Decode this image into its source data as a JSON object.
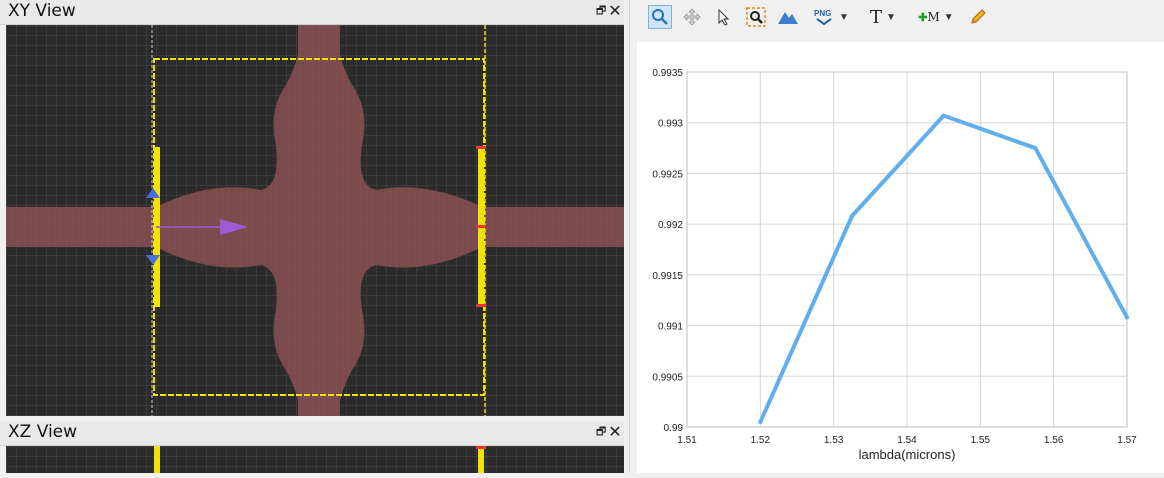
{
  "xy_view": {
    "title": "XY View"
  },
  "xz_view": {
    "title": "XZ View"
  },
  "window_controls": {
    "restore_glyph": "🗗",
    "close_glyph": "✕"
  },
  "toolbar": {
    "png_label": "PNG",
    "text_label": "T",
    "marker_label": "M"
  },
  "colors": {
    "sim_background": "#2b2b2b",
    "grid": "#4a4a4a",
    "waveguide": "#7a4a4c",
    "monitor": "#f2e20a",
    "source": "#9b5bd4",
    "plot_line": "#61aeee"
  },
  "chart_data": {
    "type": "line",
    "x": [
      1.52,
      1.5325,
      1.545,
      1.5575,
      1.57
    ],
    "series": [
      {
        "values": [
          0.99005,
          0.99208,
          0.99307,
          0.99275,
          0.99108
        ]
      }
    ],
    "xlabel": "lambda(microns)",
    "ylabel": "",
    "xlim": [
      1.51,
      1.57
    ],
    "ylim": [
      0.99,
      0.9935
    ],
    "xticks": [
      "1.51",
      "1.52",
      "1.53",
      "1.54",
      "1.55",
      "1.56",
      "1.57"
    ],
    "yticks": [
      "0.99",
      "0.9905",
      "0.991",
      "0.9915",
      "0.992",
      "0.9925",
      "0.993",
      "0.9935"
    ],
    "grid": true
  }
}
